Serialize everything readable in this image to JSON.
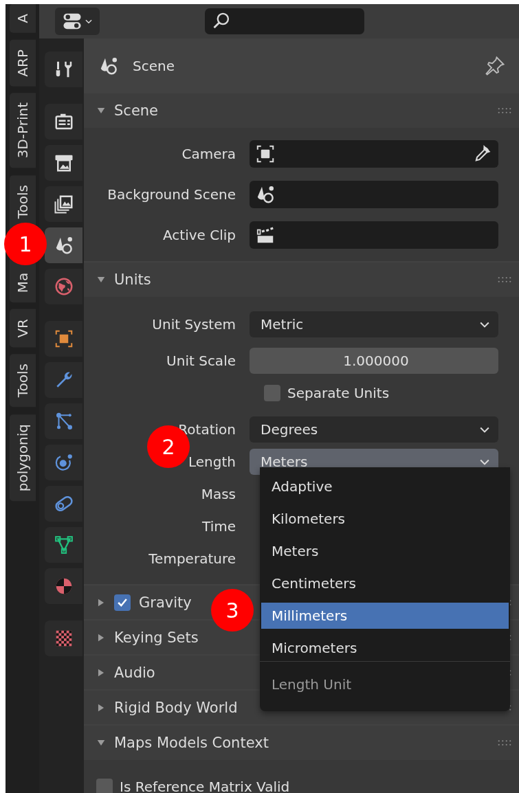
{
  "side_tabs": [
    {
      "label": "A"
    },
    {
      "label": "ARP"
    },
    {
      "label": "3D-Print"
    },
    {
      "label": "Ma Tools"
    },
    {
      "label": "VR"
    },
    {
      "label": "Tools"
    },
    {
      "label": "polygoniq"
    }
  ],
  "property_tabs": [
    {
      "tabs": [
        {
          "kind": "tool",
          "selected": false
        }
      ]
    },
    {
      "tabs": [
        {
          "kind": "render",
          "selected": false
        },
        {
          "kind": "output",
          "selected": false
        },
        {
          "kind": "viewlayer",
          "selected": false
        },
        {
          "kind": "scene",
          "selected": true
        },
        {
          "kind": "world",
          "selected": false
        }
      ]
    },
    {
      "tabs": [
        {
          "kind": "object",
          "selected": false
        },
        {
          "kind": "modifier",
          "selected": false
        },
        {
          "kind": "particles",
          "selected": false
        },
        {
          "kind": "physics",
          "selected": false
        },
        {
          "kind": "constraints",
          "selected": false
        },
        {
          "kind": "data",
          "selected": false
        },
        {
          "kind": "material",
          "selected": false
        }
      ]
    },
    {
      "tabs": [
        {
          "kind": "texture",
          "selected": false
        }
      ]
    }
  ],
  "context": {
    "title": "Scene"
  },
  "panels": [
    {
      "title": "Scene",
      "expanded": true,
      "rows": [
        {
          "kind": "camera",
          "label": "Camera"
        },
        {
          "kind": "scene",
          "label": "Background Scene"
        },
        {
          "kind": "clip",
          "label": "Active Clip"
        }
      ]
    },
    {
      "title": "Units",
      "expanded": true,
      "rows": [
        {
          "kind": "dropdown",
          "label": "Unit System",
          "value": "Metric",
          "open": false
        },
        {
          "kind": "number",
          "label": "Unit Scale",
          "value": "1.000000"
        },
        {
          "kind": "checkbox",
          "label": "Separate Units",
          "checked": false
        },
        {
          "kind": "dropdown",
          "label": "Rotation",
          "value": "Degrees",
          "open": false
        },
        {
          "kind": "dropdown",
          "label": "Length",
          "value": "Meters",
          "open": true
        },
        {
          "kind": "dropdown",
          "label": "Mass"
        },
        {
          "kind": "dropdown",
          "label": "Time"
        },
        {
          "kind": "dropdown",
          "label": "Temperature"
        }
      ]
    },
    {
      "title": "Gravity",
      "expanded": false,
      "checked": true
    },
    {
      "title": "Keying Sets",
      "expanded": false
    },
    {
      "title": "Audio",
      "expanded": false
    },
    {
      "title": "Rigid Body World",
      "expanded": false
    },
    {
      "title": "Maps Models Context",
      "expanded": true,
      "rows": [
        {
          "kind": "option",
          "label": "Is Reference Matrix Valid",
          "checked": false
        }
      ]
    }
  ],
  "menu": {
    "items": [
      {
        "label": "Adaptive",
        "selected": false
      },
      {
        "label": "Kilometers",
        "selected": false
      },
      {
        "label": "Meters",
        "selected": false
      },
      {
        "label": "Centimeters",
        "selected": false
      },
      {
        "label": "Millimeters",
        "selected": true
      },
      {
        "label": "Micrometers",
        "selected": false
      }
    ],
    "title": "Length Unit"
  },
  "annotations": [
    {
      "label": "1"
    },
    {
      "label": "2"
    },
    {
      "label": "3"
    }
  ]
}
